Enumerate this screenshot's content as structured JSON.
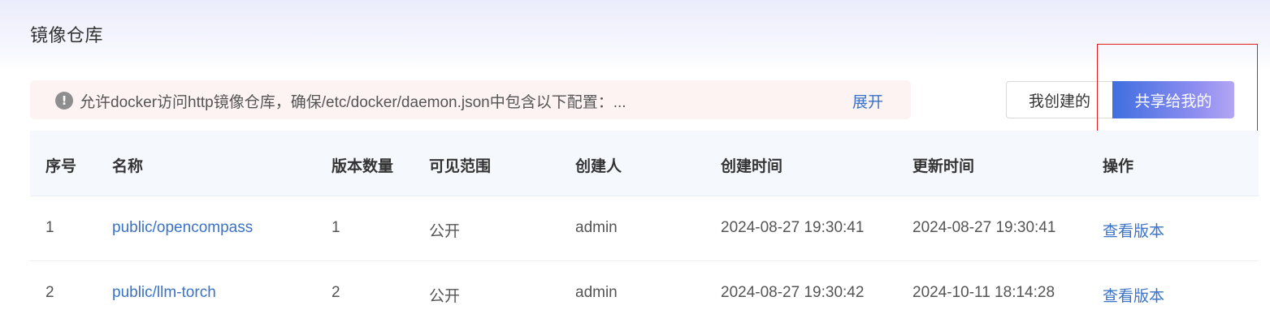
{
  "page": {
    "title": "镜像仓库"
  },
  "notice": {
    "icon": "exclamation-circle-icon",
    "text": "允许docker访问http镜像仓库，确保/etc/docker/daemon.json中包含以下配置：...",
    "expand_label": "展开"
  },
  "toggle": {
    "mine_label": "我创建的",
    "shared_label": "共享给我的",
    "active": "shared"
  },
  "table": {
    "columns": [
      "序号",
      "名称",
      "版本数量",
      "可见范围",
      "创建人",
      "创建时间",
      "更新时间",
      "操作"
    ],
    "rows": [
      {
        "index": "1",
        "name": "public/opencompass",
        "version_count": "1",
        "visibility": "公开",
        "creator": "admin",
        "created_at": "2024-08-27 19:30:41",
        "updated_at": "2024-08-27 19:30:41",
        "action": "查看版本"
      },
      {
        "index": "2",
        "name": "public/llm-torch",
        "version_count": "2",
        "visibility": "公开",
        "creator": "admin",
        "created_at": "2024-08-27 19:30:42",
        "updated_at": "2024-10-11 18:14:28",
        "action": "查看版本"
      }
    ]
  },
  "colors": {
    "accent": "#3a72c8",
    "highlight": "#e21b1b",
    "notice_bg": "#fdf3f3",
    "header_bg": "#f5f8fc"
  }
}
